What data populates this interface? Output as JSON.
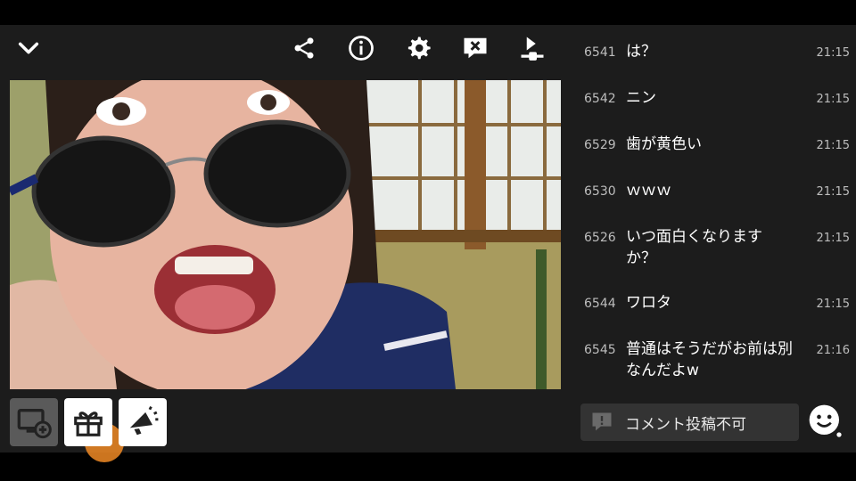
{
  "toolbar": {
    "icons": [
      "chevron-down-icon",
      "share-icon",
      "info-icon",
      "gear-icon",
      "comment-off-icon",
      "skip-icon"
    ]
  },
  "chat": {
    "messages": [
      {
        "num": "6541",
        "text": "は？",
        "time": "21:15"
      },
      {
        "num": "6542",
        "text": "ニン",
        "time": "21:15"
      },
      {
        "num": "6529",
        "text": "歯が黄色い",
        "time": "21:15"
      },
      {
        "num": "6530",
        "text": "ｗｗｗ",
        "time": "21:15"
      },
      {
        "num": "6526",
        "text": "いつ面白くなりますか？",
        "time": "21:15"
      },
      {
        "num": "6544",
        "text": "ワロタ",
        "time": "21:15"
      },
      {
        "num": "6545",
        "text": "普通はそうだがお前は別なんだよw",
        "time": "21:16"
      }
    ]
  },
  "comment_bar": {
    "label": "コメント投稿不可",
    "icon": "comment-disabled-icon"
  },
  "actions": {
    "icons": [
      "screen-add-icon",
      "gift-icon",
      "megaphone-icon"
    ]
  },
  "colors": {
    "background": "#1c1c1c",
    "accent_orange": "#f08a24",
    "text_secondary": "#bdbdbd"
  }
}
